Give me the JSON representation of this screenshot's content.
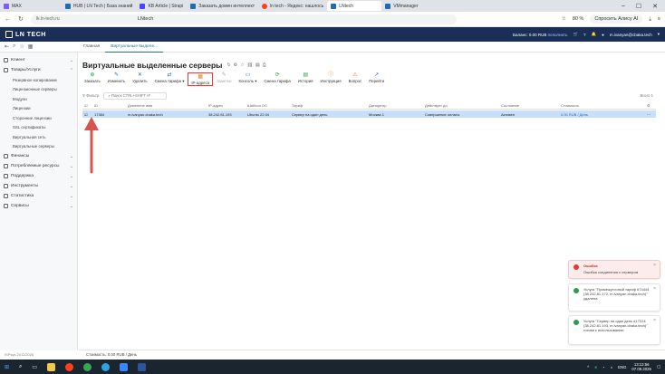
{
  "browser": {
    "tabs": [
      {
        "label": "MAX"
      },
      {
        "label": "HUB | LN Tech | База знаний"
      },
      {
        "label": "KB Article | Strapi"
      },
      {
        "label": "Заказать домен интеллект"
      },
      {
        "label": "ln tech - Яндекс: нашлось"
      },
      {
        "label": "LNtech",
        "active": true
      },
      {
        "label": "VMmanager"
      }
    ],
    "win_controls": {
      "min": "–",
      "max": "☐",
      "close": "✕"
    },
    "url": "lk.ln-tech.ru",
    "page_title": "LNtech",
    "zoom": "80 %",
    "ask_ai": "Спросить Алису AI"
  },
  "header": {
    "logo": "LN TECH",
    "balance_label": "Баланс:",
    "balance_value": "0.00 RUB",
    "balance_link": "пополнить",
    "user": "m.ivanyan@cbaka.tech"
  },
  "subnav": {
    "tabs": [
      {
        "label": "Главная",
        "active": false
      },
      {
        "label": "Виртуальные выделе...",
        "active": true
      }
    ]
  },
  "sidebar": {
    "sections": [
      {
        "label": "Клиент",
        "icon": "user-icon"
      },
      {
        "label": "Товары/Услуги",
        "icon": "box-icon",
        "expanded": true
      }
    ],
    "sub_items": [
      "Резервное копирование",
      "Лицензионные серверы",
      "Модули",
      "Лицензии",
      "Сторонние лицензии",
      "SSL сертификаты",
      "Виртуальная сеть",
      "Виртуальные серверы"
    ],
    "sections2": [
      {
        "label": "Финансы",
        "icon": "wallet-icon"
      },
      {
        "label": "Потребляемые ресурсы",
        "icon": "chart-icon"
      },
      {
        "label": "Поддержка",
        "icon": "support-icon"
      },
      {
        "label": "Инструменты",
        "icon": "tools-icon"
      },
      {
        "label": "Статистика",
        "icon": "stats-icon"
      },
      {
        "label": "Сервисы",
        "icon": "grid-icon"
      }
    ],
    "version": "ISPsys 2011/2026"
  },
  "page": {
    "title": "Виртуальные выделенные серверы"
  },
  "toolbar": [
    {
      "label": "Заказать",
      "icon": "⊕"
    },
    {
      "label": "Изменить",
      "icon": "✎"
    },
    {
      "label": "Удалить",
      "icon": "✕"
    },
    {
      "label": "Смена тарифа ▾",
      "icon": "⇄"
    },
    {
      "label": "IP-адреса",
      "icon": "▦",
      "highlight": true
    },
    {
      "label": "Заметки",
      "icon": "✎",
      "disabled": true
    },
    {
      "label": "Консоль ▾",
      "icon": "▭"
    },
    {
      "label": "Смена тарифа",
      "icon": "⟳"
    },
    {
      "label": "История",
      "icon": "▤"
    },
    {
      "label": "Инструкция",
      "icon": "ⓘ"
    },
    {
      "label": "Вопрос",
      "icon": "⚠"
    },
    {
      "label": "Перейти",
      "icon": "↗"
    }
  ],
  "filter": {
    "filter_label": "Фильтр",
    "search_placeholder": "Поиск CTRL+SHIFT+F",
    "pager": "Всего 1"
  },
  "table": {
    "columns": [
      "ID",
      "Доменное имя",
      "IP-адрес",
      "Шаблон ОС",
      "Тариф",
      "Датацентр",
      "Действует до",
      "Состояние",
      "Стоимость"
    ],
    "row": {
      "id": "17384",
      "domain": "m.ivanyan.cbaka.tech",
      "ip": "38.242.81.193",
      "os": "Ubuntu 22.04",
      "tariff": "Сервер на один день",
      "dc": "Москва 1",
      "until": "Совершение оплаты",
      "state": "Активен",
      "cost": "0.00 RUB / День"
    }
  },
  "footer": {
    "cost": "Стоимость: 0.00 RUB / День"
  },
  "toasts": [
    {
      "title": "Ошибка",
      "text": "Ошибка соединения с сервером",
      "type": "error"
    },
    {
      "text": "Услуга \"Промежуточный тариф #74444 (38.242.81.172, m.ivanyan.cbaka.tech)\" удалена",
      "type": "success"
    },
    {
      "text": "Услуга \"Сервер на один день #17224 (38.242.81.193, m.ivanyan.cbaka.tech)\" готова к использованию",
      "type": "success"
    }
  ],
  "taskbar": {
    "lang": "ENG",
    "time": "13:13:56",
    "date": "07.09.2026"
  },
  "colors": {
    "header_bg": "#1a2f56",
    "selected_row": "#c9defa",
    "highlight_box": "#e53935",
    "arrow": "#d9534f",
    "success": "#2e9b4d",
    "error": "#e53935"
  }
}
